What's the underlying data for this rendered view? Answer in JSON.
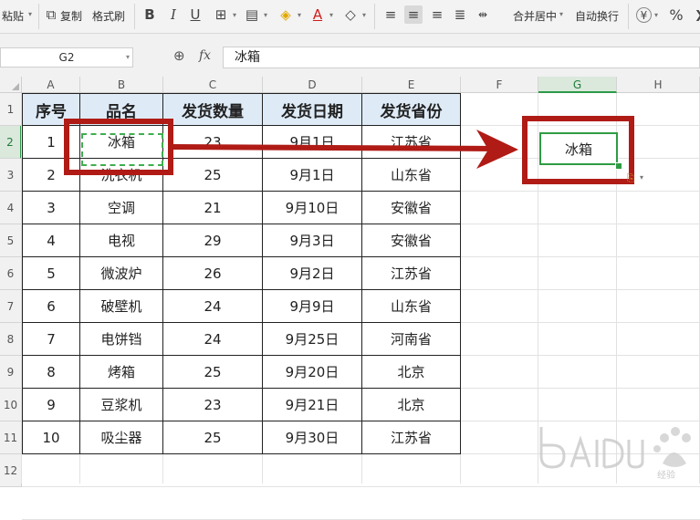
{
  "ribbon": {
    "paste_label": "粘贴",
    "copy_label": "复制",
    "format_painter_label": "格式刷",
    "merge_center_label": "合并居中",
    "wrap_text_label": "自动换行",
    "percent_symbol": "%",
    "currency_symbol": "¥",
    "bold_glyph": "B",
    "italic_glyph": "I",
    "underline_glyph": "U",
    "font_color_glyph": "A"
  },
  "formula_bar": {
    "name_box": "G2",
    "fx_label": "fx",
    "content": "冰箱"
  },
  "columns": [
    "A",
    "B",
    "C",
    "D",
    "E",
    "F",
    "G",
    "H"
  ],
  "rows": [
    "1",
    "2",
    "3",
    "4",
    "5",
    "6",
    "7",
    "8",
    "9",
    "10",
    "11",
    "12"
  ],
  "table": {
    "headers": [
      "序号",
      "品名",
      "发货数量",
      "发货日期",
      "发货省份"
    ],
    "rows": [
      [
        "1",
        "冰箱",
        "23",
        "9月1日",
        "江苏省"
      ],
      [
        "2",
        "洗衣机",
        "25",
        "9月1日",
        "山东省"
      ],
      [
        "3",
        "空调",
        "21",
        "9月10日",
        "安徽省"
      ],
      [
        "4",
        "电视",
        "29",
        "9月3日",
        "安徽省"
      ],
      [
        "5",
        "微波炉",
        "26",
        "9月2日",
        "江苏省"
      ],
      [
        "6",
        "破壁机",
        "24",
        "9月9日",
        "山东省"
      ],
      [
        "7",
        "电饼铛",
        "24",
        "9月25日",
        "河南省"
      ],
      [
        "8",
        "烤箱",
        "25",
        "9月20日",
        "北京"
      ],
      [
        "9",
        "豆浆机",
        "23",
        "9月21日",
        "北京"
      ],
      [
        "10",
        "吸尘器",
        "25",
        "9月30日",
        "江苏省"
      ]
    ]
  },
  "selected_cell": {
    "ref": "G2",
    "value": "冰箱"
  },
  "colors": {
    "accent_red": "#b01b16",
    "select_green": "#2e9c43",
    "header_fill": "#deebf7"
  },
  "icons": [
    "copy-icon",
    "format-painter-icon",
    "border-icon",
    "fill-color-icon",
    "eraser-icon",
    "align-left-icon",
    "align-center-icon",
    "align-right-icon",
    "justify-icon",
    "zoom-icon",
    "paste-options-icon"
  ]
}
